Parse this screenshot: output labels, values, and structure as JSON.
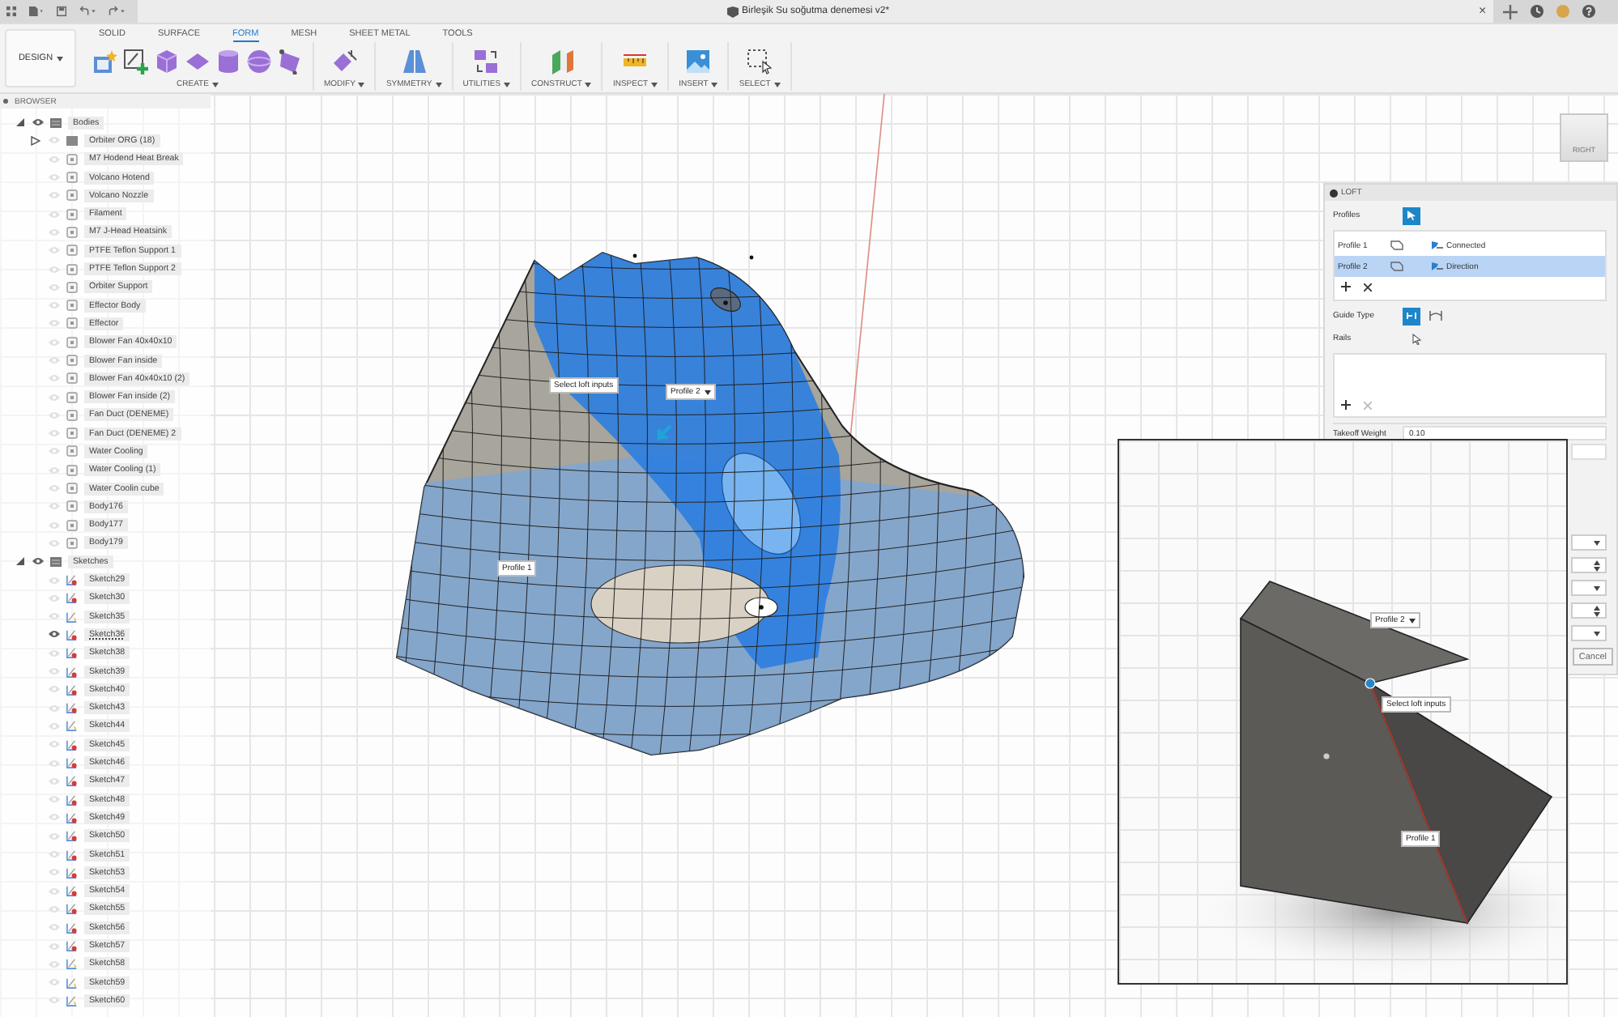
{
  "window": {
    "title": "Birleşik Su soğutma denemesi v2*",
    "close": "×"
  },
  "workspace": {
    "label": "DESIGN"
  },
  "tabs": [
    {
      "label": "SOLID",
      "selected": false
    },
    {
      "label": "SURFACE",
      "selected": false
    },
    {
      "label": "FORM",
      "selected": true
    },
    {
      "label": "MESH",
      "selected": false
    },
    {
      "label": "SHEET METAL",
      "selected": false
    },
    {
      "label": "TOOLS",
      "selected": false
    }
  ],
  "toolbar_groups": [
    "CREATE",
    "MODIFY",
    "SYMMETRY",
    "UTILITIES",
    "CONSTRUCT",
    "INSPECT",
    "INSERT",
    "SELECT"
  ],
  "browser": {
    "title": "BROWSER",
    "folders": [
      {
        "label": "Bodies",
        "expanded": true,
        "visible": true,
        "children": [
          {
            "label": "Orbiter ORG (18)",
            "kind": "folder",
            "visible": false
          },
          {
            "label": "M7 Hodend Heat Break",
            "kind": "body",
            "visible": false
          },
          {
            "label": "Volcano Hotend",
            "kind": "body",
            "visible": false
          },
          {
            "label": "Volcano Nozzle",
            "kind": "body",
            "visible": false
          },
          {
            "label": "Filament",
            "kind": "body",
            "visible": false
          },
          {
            "label": "M7 J-Head Heatsink",
            "kind": "body",
            "visible": false
          },
          {
            "label": "PTFE Teflon Support 1",
            "kind": "body",
            "visible": false
          },
          {
            "label": "PTFE Teflon Support 2",
            "kind": "body",
            "visible": false
          },
          {
            "label": "Orbiter Support",
            "kind": "body",
            "visible": false
          },
          {
            "label": "Effector Body",
            "kind": "body",
            "visible": false
          },
          {
            "label": "Effector",
            "kind": "body",
            "visible": false
          },
          {
            "label": "Blower Fan 40x40x10",
            "kind": "body",
            "visible": false
          },
          {
            "label": "Blower Fan inside",
            "kind": "body",
            "visible": false
          },
          {
            "label": "Blower Fan 40x40x10 (2)",
            "kind": "body",
            "visible": false
          },
          {
            "label": "Blower Fan inside (2)",
            "kind": "body",
            "visible": false
          },
          {
            "label": "Fan Duct (DENEME)",
            "kind": "body",
            "visible": false
          },
          {
            "label": "Fan Duct (DENEME) 2",
            "kind": "body",
            "visible": false
          },
          {
            "label": "Water Cooling",
            "kind": "body",
            "visible": false
          },
          {
            "label": "Water Cooling (1)",
            "kind": "body",
            "visible": false
          },
          {
            "label": "Water Coolin cube",
            "kind": "body",
            "visible": false
          },
          {
            "label": "Body176",
            "kind": "body",
            "visible": false
          },
          {
            "label": "Body177",
            "kind": "body",
            "visible": false
          },
          {
            "label": "Body179",
            "kind": "body",
            "visible": false
          }
        ]
      },
      {
        "label": "Sketches",
        "expanded": true,
        "visible": true,
        "children": [
          {
            "label": "Sketch29",
            "kind": "sketch",
            "warning": true,
            "visible": false
          },
          {
            "label": "Sketch30",
            "kind": "sketch",
            "warning": true,
            "visible": false
          },
          {
            "label": "Sketch35",
            "kind": "sketch",
            "warning": false,
            "visible": false
          },
          {
            "label": "Sketch36",
            "kind": "sketch",
            "warning": true,
            "visible": true
          },
          {
            "label": "Sketch38",
            "kind": "sketch",
            "warning": true,
            "visible": false
          },
          {
            "label": "Sketch39",
            "kind": "sketch",
            "warning": true,
            "visible": false
          },
          {
            "label": "Sketch40",
            "kind": "sketch",
            "warning": true,
            "visible": false
          },
          {
            "label": "Sketch43",
            "kind": "sketch",
            "warning": true,
            "visible": false
          },
          {
            "label": "Sketch44",
            "kind": "sketch",
            "warning": false,
            "visible": false
          },
          {
            "label": "Sketch45",
            "kind": "sketch",
            "warning": true,
            "visible": false
          },
          {
            "label": "Sketch46",
            "kind": "sketch",
            "warning": true,
            "visible": false
          },
          {
            "label": "Sketch47",
            "kind": "sketch",
            "warning": true,
            "visible": false
          },
          {
            "label": "Sketch48",
            "kind": "sketch",
            "warning": true,
            "visible": false
          },
          {
            "label": "Sketch49",
            "kind": "sketch",
            "warning": true,
            "visible": false
          },
          {
            "label": "Sketch50",
            "kind": "sketch",
            "warning": true,
            "visible": false
          },
          {
            "label": "Sketch51",
            "kind": "sketch",
            "warning": true,
            "visible": false
          },
          {
            "label": "Sketch53",
            "kind": "sketch",
            "warning": true,
            "visible": false
          },
          {
            "label": "Sketch54",
            "kind": "sketch",
            "warning": true,
            "visible": false
          },
          {
            "label": "Sketch55",
            "kind": "sketch",
            "warning": true,
            "visible": false
          },
          {
            "label": "Sketch56",
            "kind": "sketch",
            "warning": true,
            "visible": false
          },
          {
            "label": "Sketch57",
            "kind": "sketch",
            "warning": true,
            "visible": false
          },
          {
            "label": "Sketch58",
            "kind": "sketch",
            "warning": false,
            "visible": false
          },
          {
            "label": "Sketch59",
            "kind": "sketch",
            "warning": false,
            "visible": false
          },
          {
            "label": "Sketch60",
            "kind": "sketch",
            "warning": false,
            "visible": false
          }
        ]
      }
    ]
  },
  "viewcube": {
    "face": "RIGHT"
  },
  "viewport": {
    "tags": [
      {
        "text": "Select loft inputs",
        "kind": "tag"
      },
      {
        "text": "Profile 2",
        "kind": "dropdown"
      },
      {
        "text": "Profile 1",
        "kind": "tag"
      }
    ]
  },
  "loft": {
    "title": "LOFT",
    "profiles_label": "Profiles",
    "profiles": [
      {
        "name": "Profile 1",
        "option": "Connected",
        "selected": false
      },
      {
        "name": "Profile 2",
        "option": "Direction",
        "selected": true
      }
    ],
    "guide_type_label": "Guide Type",
    "rails_label": "Rails",
    "takeoff_weight": {
      "label": "Takeoff Weight",
      "value": "0.10"
    },
    "cancel": "Cancel"
  },
  "inset": {
    "tags": [
      {
        "text": "Profile 2",
        "kind": "dropdown"
      },
      {
        "text": "Select loft inputs",
        "kind": "tag"
      },
      {
        "text": "Profile 1",
        "kind": "tag"
      }
    ]
  }
}
